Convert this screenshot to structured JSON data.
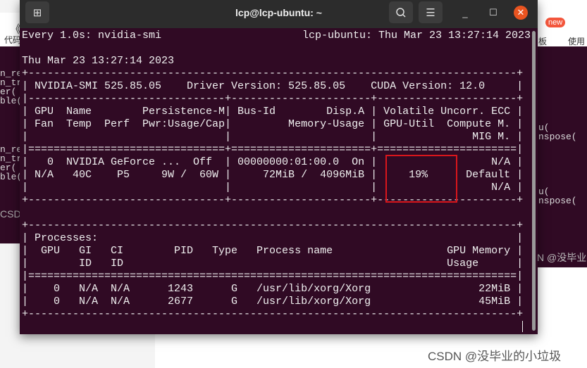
{
  "background": {
    "left_tabs": [
      "《/",
      "代码"
    ],
    "left_code": [
      "n_re\nn_tr\ner(\nble(",
      "n_re\nn_tr\ner(\nble("
    ],
    "left_fragment": "CSD",
    "right_badge": "new",
    "right_tabs": [
      "板",
      "使用"
    ],
    "right_code": [
      "u(\nnspose(",
      "u(\nnspose("
    ],
    "right_fragment": "N @没毕业",
    "watermark": "CSDN @没毕业的小垃圾"
  },
  "window": {
    "title": "lcp@lcp-ubuntu: ~",
    "icons": {
      "new_tab": "new-tab-icon",
      "search": "search-icon",
      "menu": "hamburger-menu-icon",
      "minimize": "minimize-icon",
      "maximize": "maximize-icon",
      "close": "close-icon"
    },
    "accent_close": "#e95420",
    "background": "#300a24"
  },
  "terminal": {
    "header_left": "Every 1.0s: nvidia-smi",
    "header_right": "lcp-ubuntu: Thu Mar 23 13:27:14 2023",
    "lines": [
      "",
      "Thu Mar 23 13:27:14 2023",
      "+-----------------------------------------------------------------------------+",
      "| NVIDIA-SMI 525.85.05    Driver Version: 525.85.05    CUDA Version: 12.0     |",
      "|-------------------------------+----------------------+----------------------+",
      "| GPU  Name        Persistence-M| Bus-Id        Disp.A | Volatile Uncorr. ECC |",
      "| Fan  Temp  Perf  Pwr:Usage/Cap|         Memory-Usage | GPU-Util  Compute M. |",
      "|                               |                      |               MIG M. |",
      "|===============================+======================+======================|",
      "|   0  NVIDIA GeForce ...  Off  | 00000000:01:00.0  On |                  N/A |",
      "| N/A   40C    P5     9W /  60W |     72MiB /  4096MiB |     19%      Default |",
      "|                               |                      |                  N/A |",
      "+-------------------------------+----------------------+----------------------+",
      "",
      "+-----------------------------------------------------------------------------+",
      "| Processes:                                                                  |",
      "|  GPU   GI   CI        PID   Type   Process name                  GPU Memory |",
      "|        ID   ID                                                   Usage      |",
      "|=============================================================================|",
      "|    0   N/A  N/A      1243      G   /usr/lib/xorg/Xorg                 22MiB |",
      "|    0   N/A  N/A      2677      G   /usr/lib/xorg/Xorg                 45MiB |",
      "+-----------------------------------------------------------------------------+"
    ],
    "highlight_color": "#d9161c"
  }
}
